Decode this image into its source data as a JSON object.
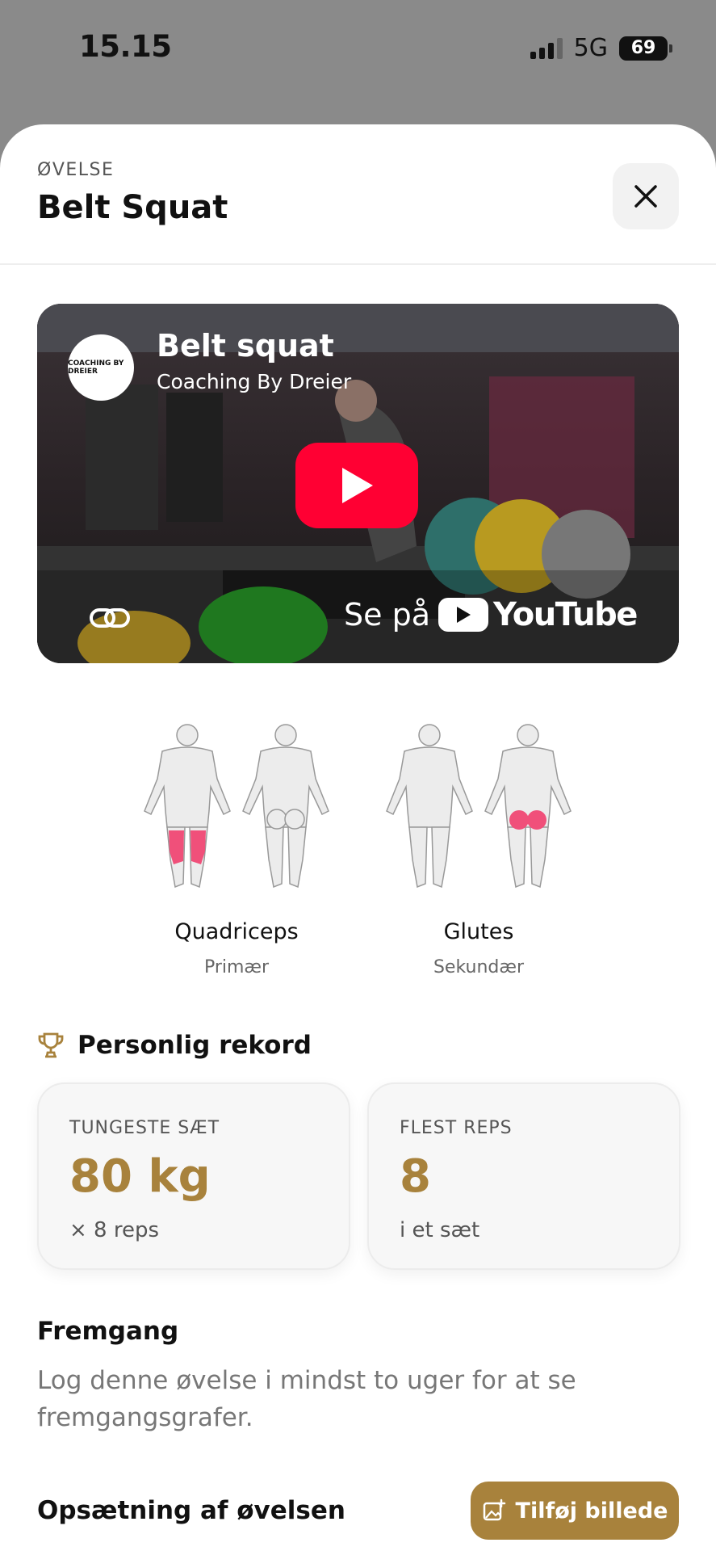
{
  "status_bar": {
    "time": "15.15",
    "network": "5G",
    "battery": "69"
  },
  "header": {
    "eyebrow": "ØVELSE",
    "title": "Belt Squat",
    "close_icon": "close-icon"
  },
  "video": {
    "title": "Belt squat",
    "channel": "Coaching By Dreier",
    "channel_logo_text": "COACHING BY DREIER",
    "watch_prefix": "Se på",
    "platform": "YouTube",
    "play_icon": "play-icon",
    "link_icon": "link-icon"
  },
  "muscles": [
    {
      "name": "Quadriceps",
      "role": "Primær",
      "highlight": "quads",
      "color": "#f0507a"
    },
    {
      "name": "Glutes",
      "role": "Sekundær",
      "highlight": "glutes",
      "color": "#f0507a"
    }
  ],
  "records": {
    "title": "Personlig rekord",
    "icon": "trophy-icon",
    "cards": [
      {
        "label": "TUNGESTE SÆT",
        "value": "80 kg",
        "sub": "× 8 reps"
      },
      {
        "label": "FLEST REPS",
        "value": "8",
        "sub": "i et sæt"
      }
    ]
  },
  "progress": {
    "title": "Fremgang",
    "text": "Log denne øvelse i mindst to uger for at se fremgangsgrafer."
  },
  "setup": {
    "title": "Opsætning af øvelsen",
    "add_image_label": "Tilføj billede",
    "add_image_icon": "add-image-icon"
  },
  "colors": {
    "accent": "#a8823c",
    "youtube_red": "#ff0033",
    "muscle_highlight": "#f0507a"
  }
}
